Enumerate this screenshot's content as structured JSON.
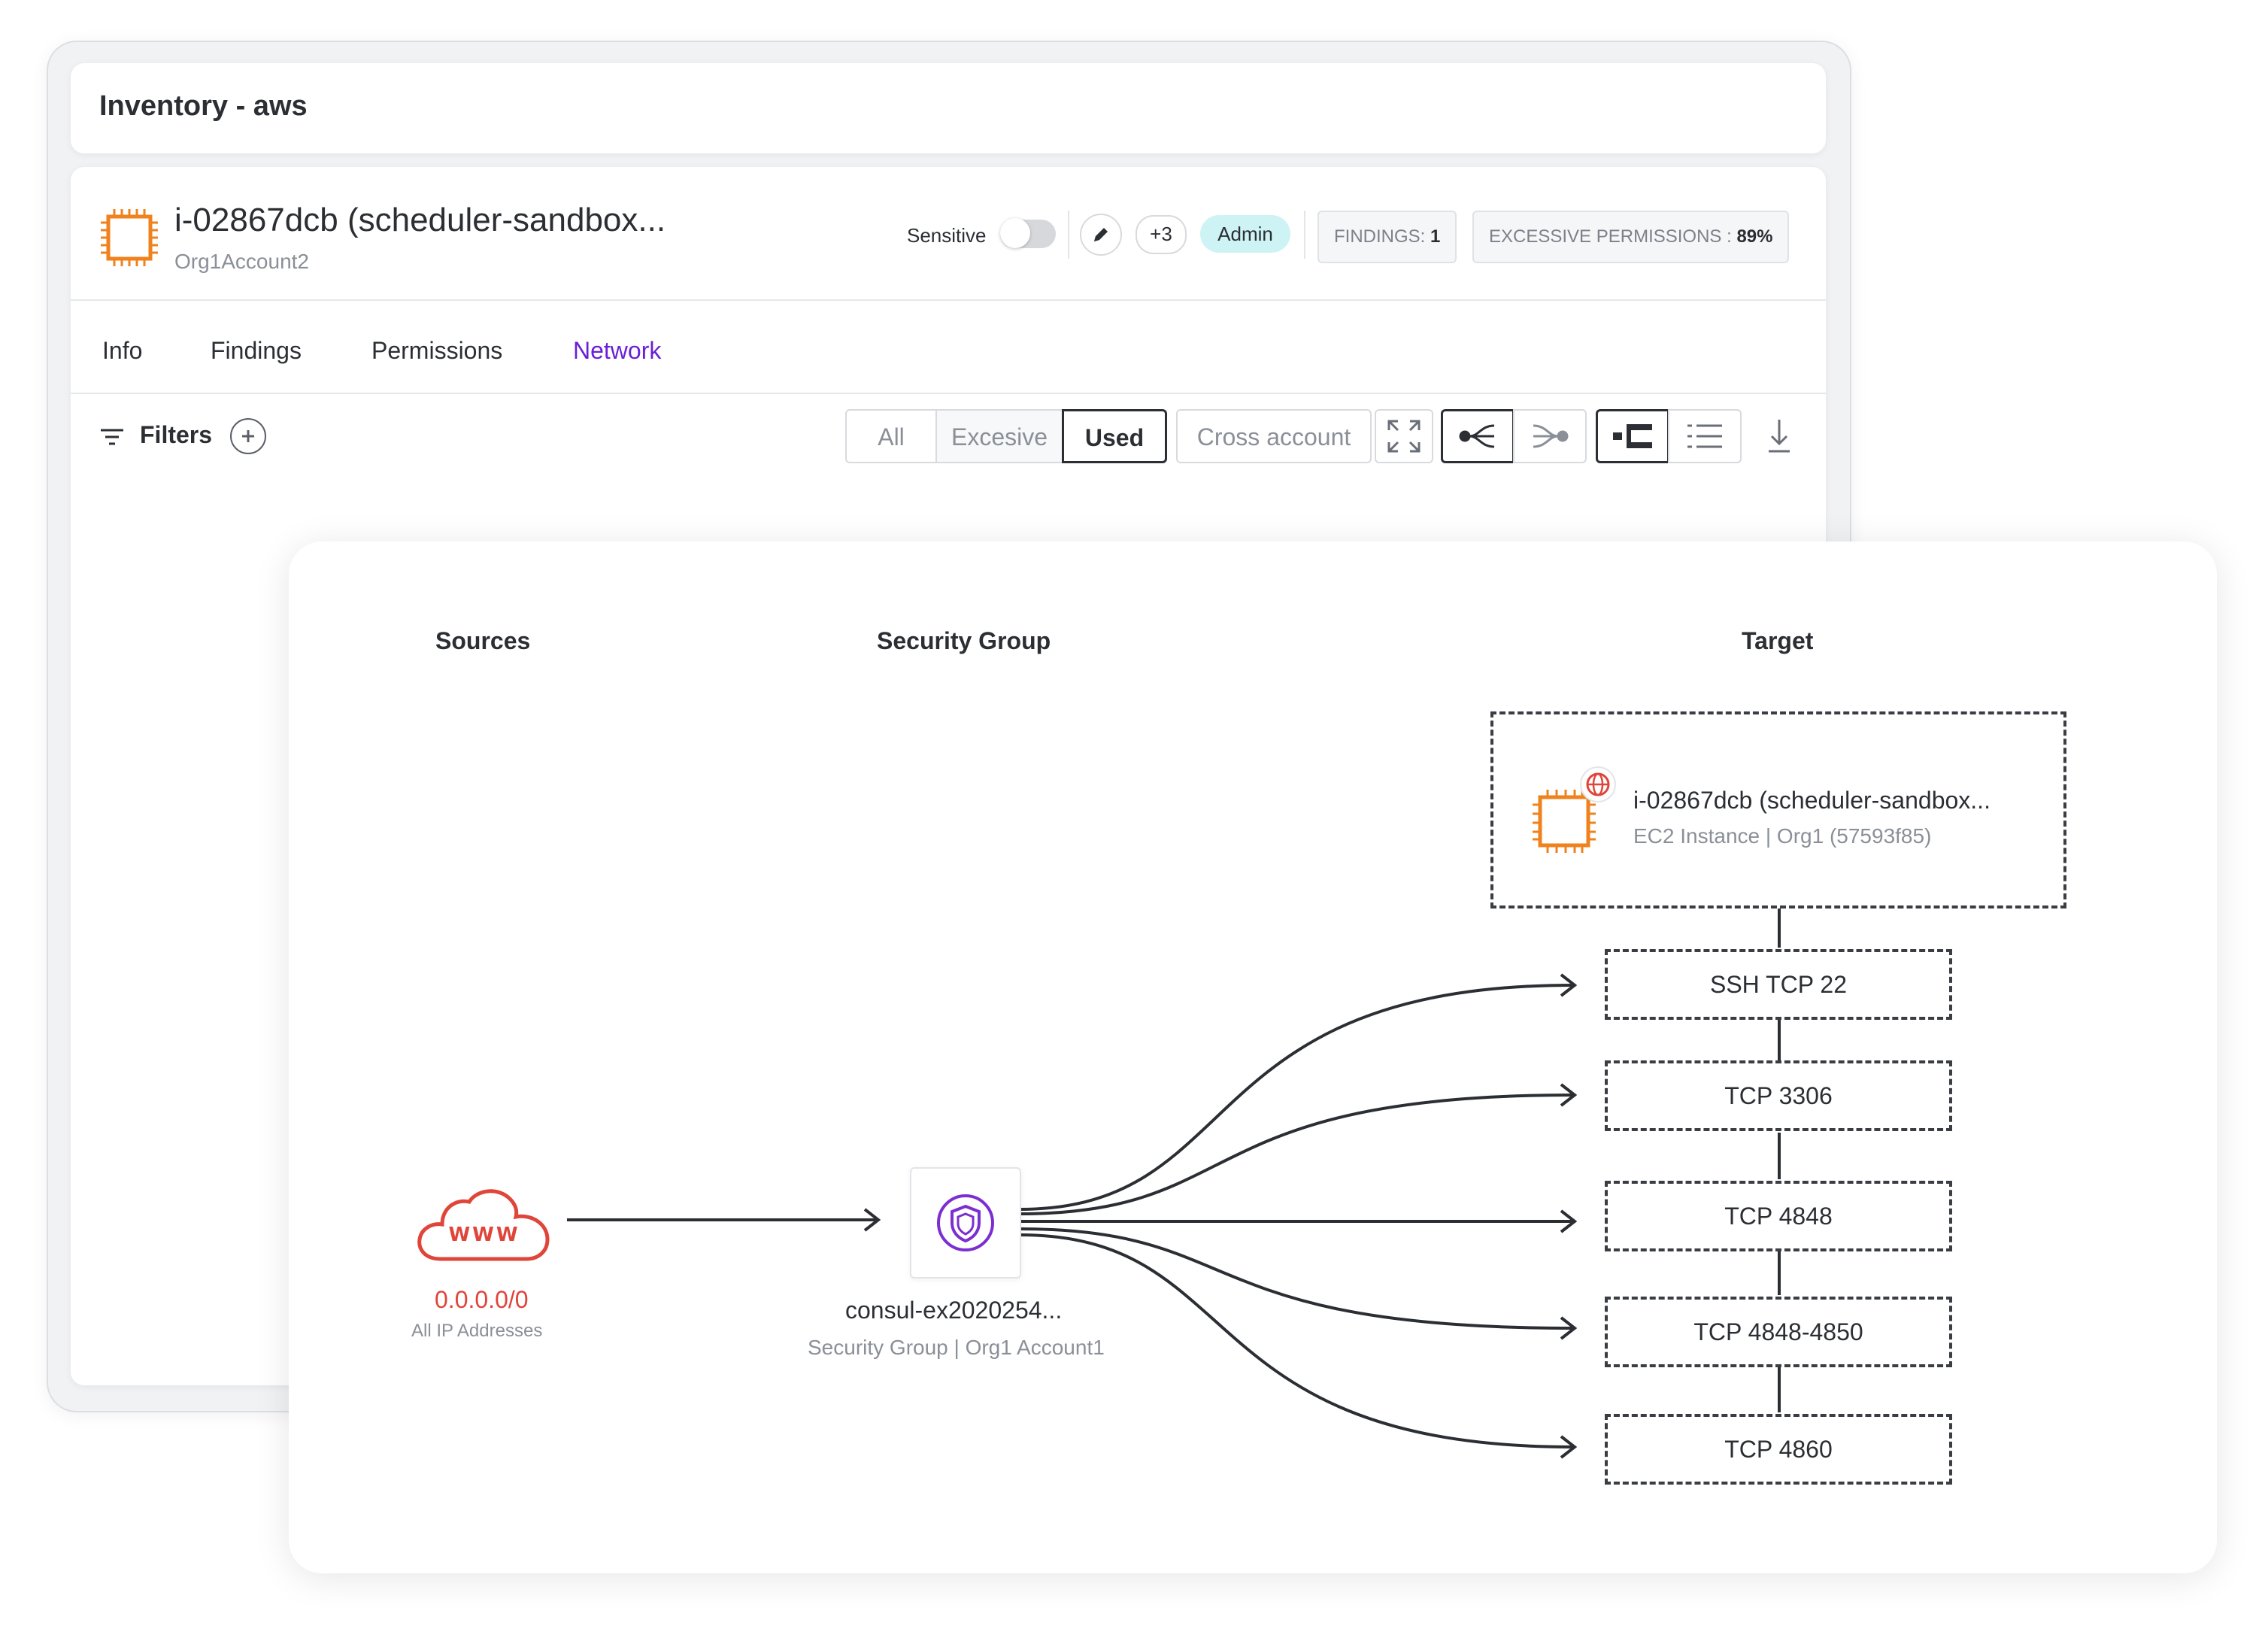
{
  "header": {
    "title": "Inventory - aws"
  },
  "resource": {
    "title": "i-02867dcb (scheduler-sandbox...",
    "account": "Org1Account2",
    "sensitive_label": "Sensitive",
    "sensitive_on": false,
    "extra_count": "+3",
    "role_badge": "Admin",
    "findings_label": "FINDINGS:",
    "findings_value": "1",
    "excessive_label": "EXCESSIVE PERMISSIONS :",
    "excessive_value": "89%"
  },
  "tabs": [
    {
      "label": "Info",
      "active": false
    },
    {
      "label": "Findings",
      "active": false
    },
    {
      "label": "Permissions",
      "active": false
    },
    {
      "label": "Network",
      "active": true
    }
  ],
  "toolbar": {
    "filters_label": "Filters",
    "segments": [
      "All",
      "Excesive",
      "Used",
      "Cross account"
    ],
    "selected_segment": "Used",
    "icons": [
      "expand-icon",
      "graph-source-icon",
      "graph-target-icon",
      "layout-split-icon",
      "list-icon",
      "download-icon"
    ]
  },
  "network": {
    "columns": {
      "sources": "Sources",
      "security_group": "Security Group",
      "target": "Target"
    },
    "source": {
      "icon_text": "WWW",
      "ip": "0.0.0.0/0",
      "subtitle": "All IP Addresses"
    },
    "security_group": {
      "name": "consul-ex2020254...",
      "subtitle": "Security Group | Org1 Account1"
    },
    "target": {
      "name": "i-02867dcb (scheduler-sandbox...",
      "subtitle": "EC2 Instance | Org1 (57593f85)"
    },
    "ports": [
      "SSH TCP 22",
      "TCP 3306",
      "TCP 4848",
      "TCP 4848-4850",
      "TCP 4860"
    ]
  },
  "colors": {
    "accent_purple": "#6b1fd6",
    "ec2_orange": "#f0821e",
    "source_red": "#e0453a",
    "admin_badge_bg": "#cdf3f5",
    "sg_purple": "#7b2fd0"
  }
}
